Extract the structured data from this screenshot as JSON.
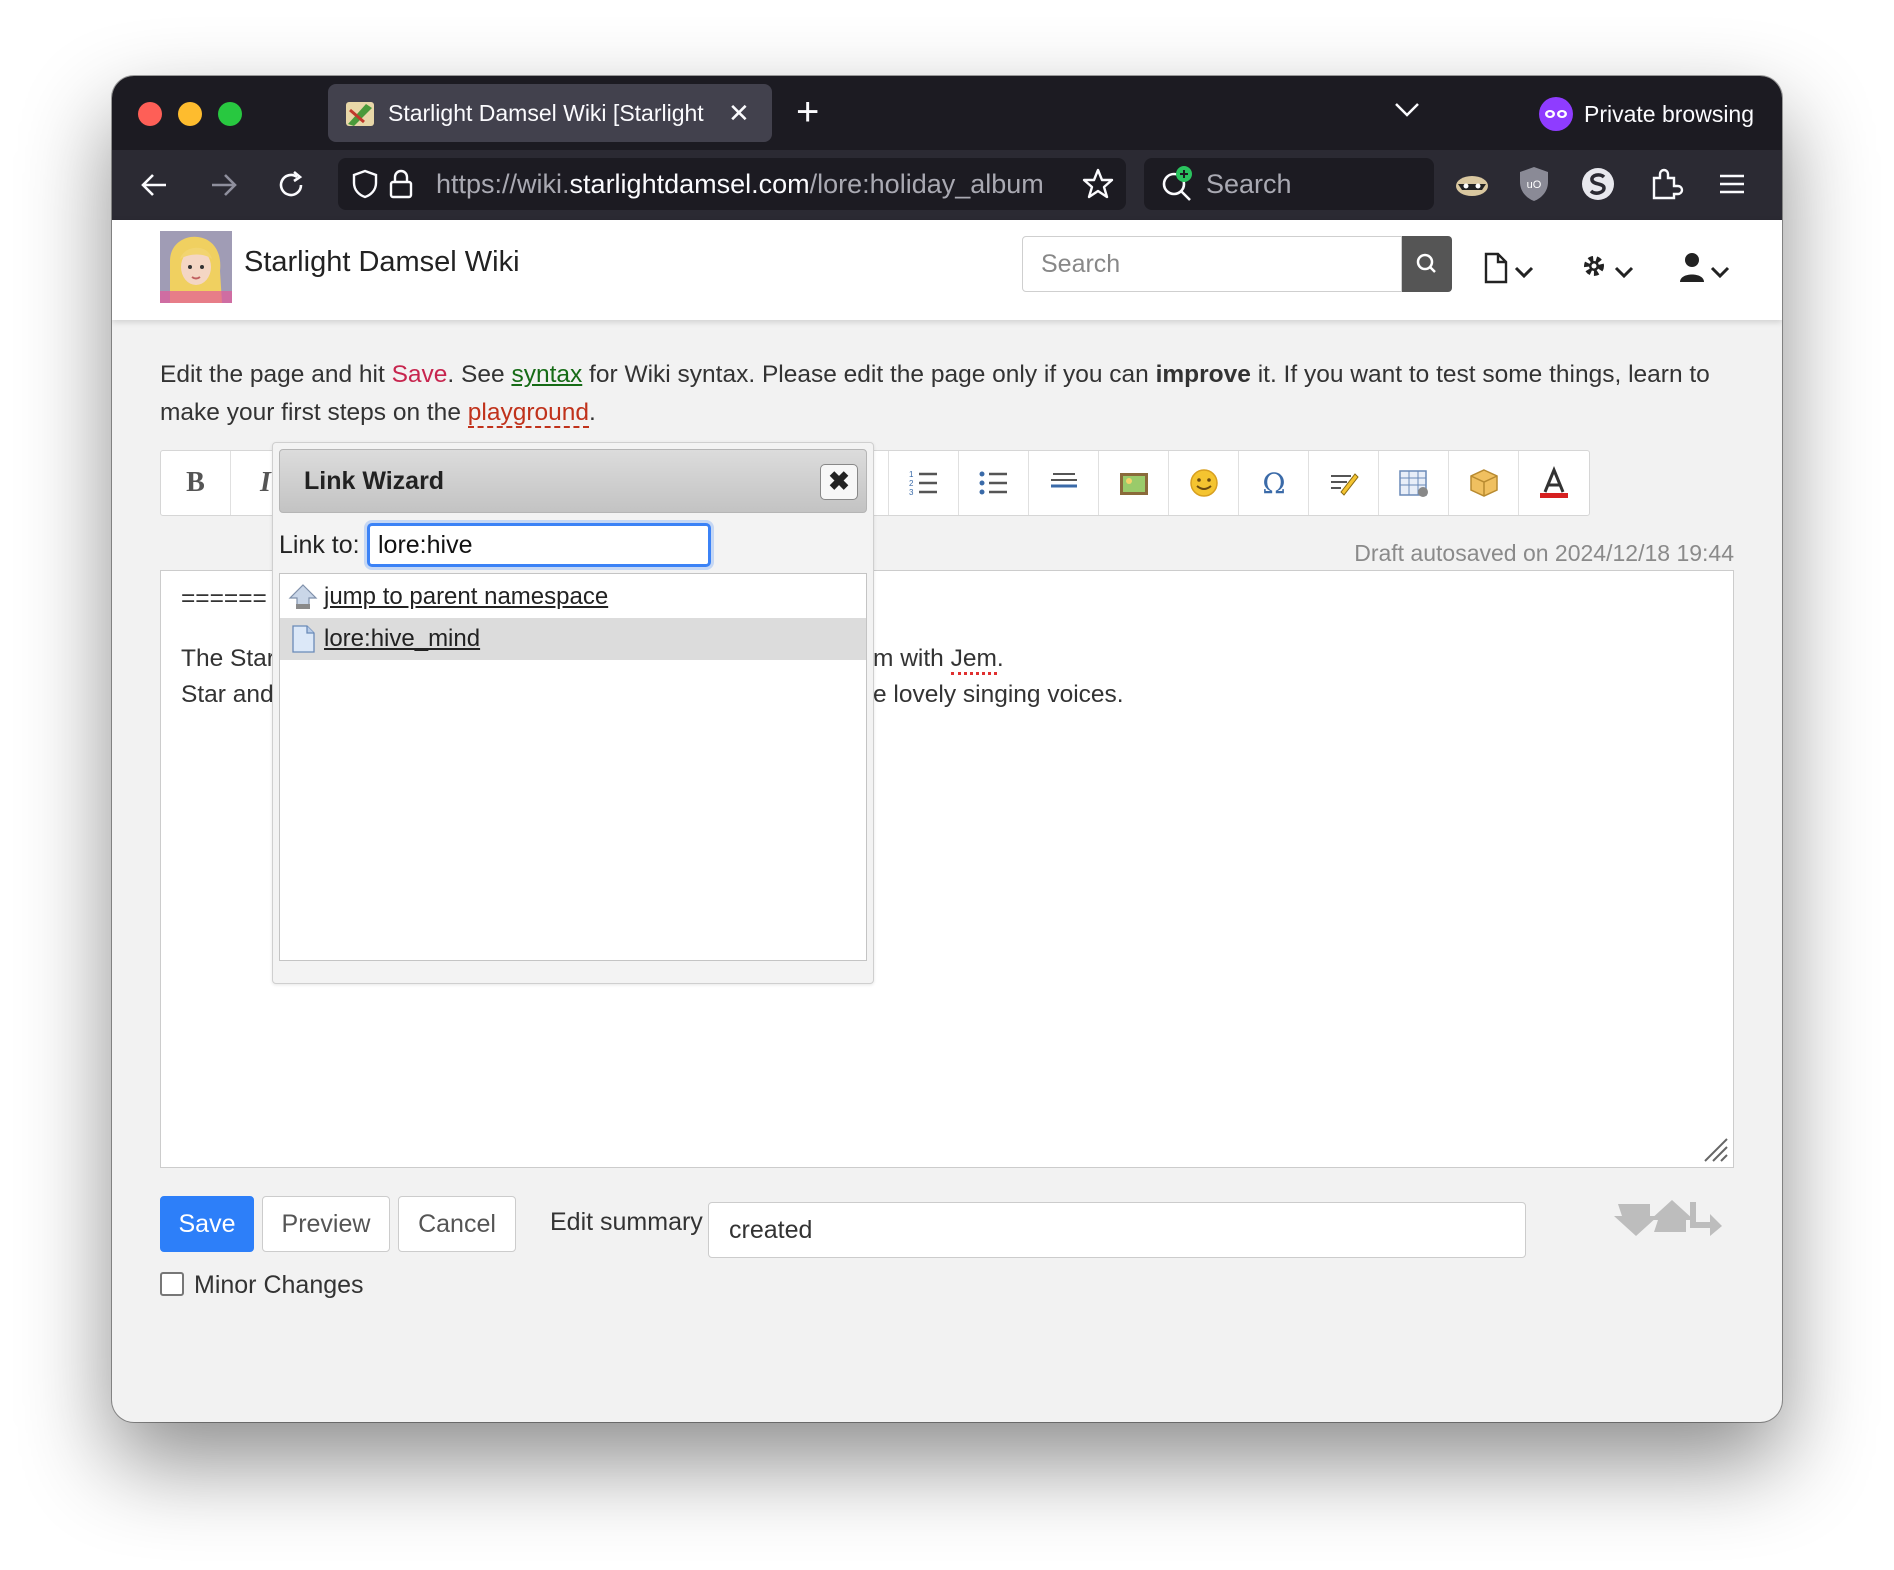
{
  "browser": {
    "tab_title": "Starlight Damsel Wiki [Starlight",
    "url_prefix": "https://wiki.",
    "url_domain": "starlightdamsel.com",
    "url_path": "/lore:holiday_album",
    "search_placeholder": "Search",
    "private_label": "Private browsing",
    "colors": {
      "tabbar": "#1c1b22",
      "navbar": "#2b2a33",
      "private_accent": "#8f3cff"
    }
  },
  "wiki": {
    "title": "Starlight Damsel Wiki",
    "search_placeholder": "Search",
    "intro": {
      "p1": "Edit the page and hit ",
      "save_kw": "Save",
      "p2": ". See ",
      "syntax_link": "syntax",
      "p3": " for Wiki syntax. Please edit the page only if you can ",
      "improve": "improve",
      "p4": " it. If you want to test some things, learn to make your first steps on the ",
      "playground_link": "playground",
      "p5": "."
    },
    "toolbar": {
      "bold": "B",
      "italic": "I",
      "buttons": [
        "link-icon",
        "ordered-list-icon",
        "unordered-list-icon",
        "horizontal-rule-icon",
        "image-icon",
        "smiley-icon",
        "special-chars-icon",
        "signature-icon",
        "insert-table-icon",
        "plugin-box-icon",
        "font-color-icon"
      ]
    },
    "draft_status": "Draft autosaved on 2024/12/18 19:44",
    "editor": {
      "line1": "======",
      "line3_left": "The Star",
      "line3_right": "m with ",
      "line3_jem": "Jem",
      "line3_end": ".",
      "line4_left": "Star and",
      "line4_right": "e lovely singing voices."
    },
    "buttons": {
      "save": "Save",
      "preview": "Preview",
      "cancel": "Cancel"
    },
    "summary_label": "Edit summary",
    "summary_value": "created",
    "minor_changes": "Minor Changes",
    "colors": {
      "primary": "#2d7ff9",
      "save_keyword": "#c7254e",
      "link_green": "#166b16",
      "link_red": "#c0321b"
    }
  },
  "link_wizard": {
    "title": "Link Wizard",
    "close": "✖",
    "link_to_label": "Link to:",
    "input_value": "lore:hive",
    "results": [
      {
        "label": "jump to parent namespace",
        "icon": "parent-namespace-icon"
      },
      {
        "label": "lore:hive_mind",
        "icon": "page-icon",
        "selected": true
      }
    ]
  }
}
